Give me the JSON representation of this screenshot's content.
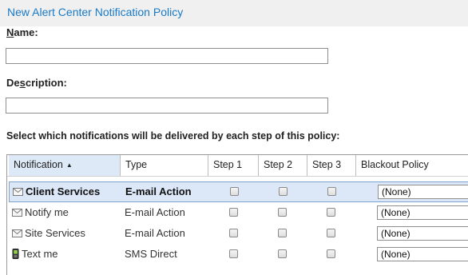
{
  "dialog": {
    "title": "New Alert Center Notification Policy"
  },
  "form": {
    "name_label_accesskey": "N",
    "name_label_rest": "ame:",
    "name_value": "",
    "description_label_pre": "De",
    "description_label_accesskey": "s",
    "description_label_rest": "cription:",
    "description_value": ""
  },
  "instructions": "Select which notifications will be delivered by each step of this policy:",
  "grid": {
    "columns": {
      "notification": "Notification",
      "type": "Type",
      "step1": "Step 1",
      "step2": "Step 2",
      "step3": "Step 3",
      "blackout": "Blackout Policy"
    },
    "sort_indicator": "▲",
    "rows": [
      {
        "icon": "envelope-icon",
        "name": "Client Services",
        "type": "E-mail Action",
        "step1": false,
        "step2": false,
        "step3": false,
        "blackout": "(None)",
        "selected": true
      },
      {
        "icon": "envelope-icon",
        "name": "Notify me",
        "type": "E-mail Action",
        "step1": false,
        "step2": false,
        "step3": false,
        "blackout": "(None)",
        "selected": false
      },
      {
        "icon": "envelope-icon",
        "name": "Site Services",
        "type": "E-mail Action",
        "step1": false,
        "step2": false,
        "step3": false,
        "blackout": "(None)",
        "selected": false
      },
      {
        "icon": "mobile-phone-icon",
        "name": "Text me",
        "type": "SMS Direct",
        "step1": false,
        "step2": false,
        "step3": false,
        "blackout": "(None)",
        "selected": false
      }
    ]
  },
  "colors": {
    "title": "#1a7ac6",
    "selected_row": "#dce8f8",
    "selected_border": "#7da2ce",
    "sorted_header": "#dde9f7"
  }
}
